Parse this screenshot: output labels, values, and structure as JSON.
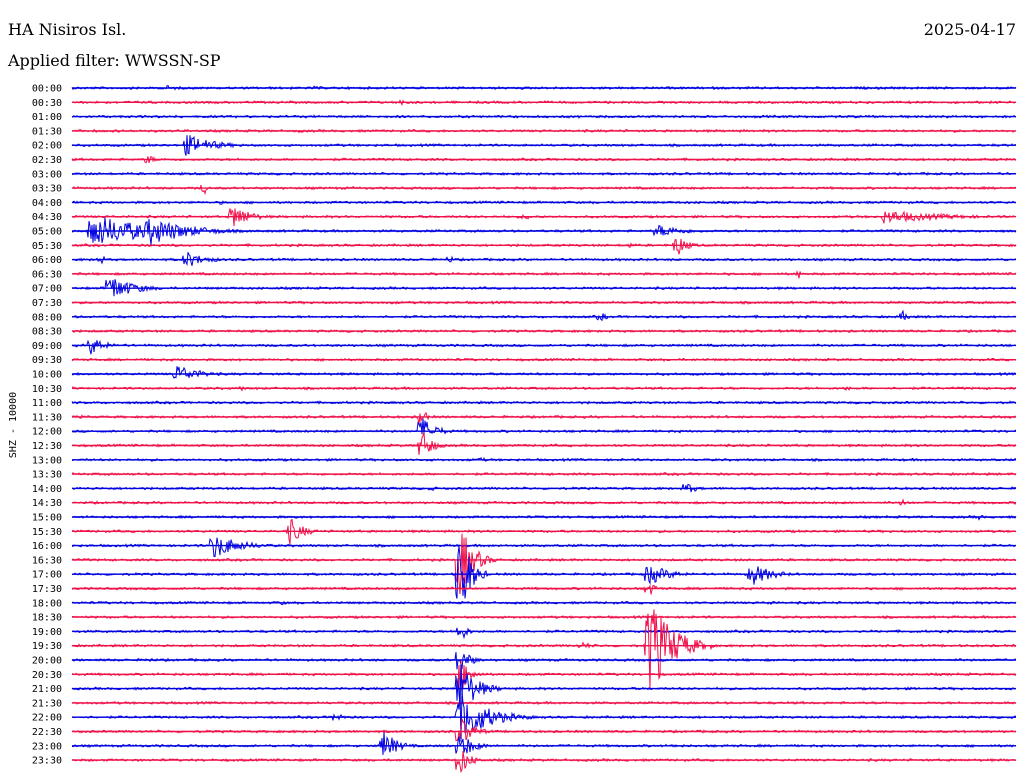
{
  "header": {
    "station": "HA Nisiros Isl.",
    "date": "2025-04-17",
    "filter": "Applied filter: WWSSN-SP"
  },
  "chart_data": {
    "type": "line",
    "title": "HA Nisiros Isl.",
    "ylabel": "SHZ - 10000",
    "colors": [
      "#0000e0",
      "#f0104a"
    ],
    "rows": [
      "00:00",
      "00:30",
      "01:00",
      "01:30",
      "02:00",
      "02:30",
      "03:00",
      "03:30",
      "04:00",
      "04:30",
      "05:00",
      "05:30",
      "06:00",
      "06:30",
      "07:00",
      "07:30",
      "08:00",
      "08:30",
      "09:00",
      "09:30",
      "10:00",
      "10:30",
      "11:00",
      "11:30",
      "12:00",
      "12:30",
      "13:00",
      "13:30",
      "14:00",
      "14:30",
      "15:00",
      "15:30",
      "16:00",
      "16:30",
      "17:00",
      "17:30",
      "18:00",
      "18:30",
      "19:00",
      "19:30",
      "20:00",
      "20:30",
      "21:00",
      "21:30",
      "22:00",
      "22:30",
      "23:00",
      "23:30"
    ],
    "events": [
      {
        "row": 0,
        "x": 0.1,
        "amp": 3,
        "dur": 0.05
      },
      {
        "row": 0,
        "x": 0.26,
        "amp": 3,
        "dur": 0.01
      },
      {
        "row": 1,
        "x": 0.35,
        "amp": 4,
        "dur": 0.02
      },
      {
        "row": 1,
        "x": 0.52,
        "amp": 2,
        "dur": 0.01
      },
      {
        "row": 3,
        "x": 0.05,
        "amp": 2,
        "dur": 0.01
      },
      {
        "row": 3,
        "x": 0.24,
        "amp": 2,
        "dur": 0.02
      },
      {
        "row": 4,
        "x": 0.12,
        "amp": 12,
        "dur": 0.08
      },
      {
        "row": 4,
        "x": 0.28,
        "amp": 2,
        "dur": 0.02
      },
      {
        "row": 4,
        "x": 0.99,
        "amp": 2,
        "dur": 0.01
      },
      {
        "row": 5,
        "x": 0.08,
        "amp": 6,
        "dur": 0.02
      },
      {
        "row": 7,
        "x": 0.14,
        "amp": 7,
        "dur": 0.01
      },
      {
        "row": 8,
        "x": 0.16,
        "amp": 3,
        "dur": 0.01
      },
      {
        "row": 9,
        "x": 0.17,
        "amp": 14,
        "dur": 0.05
      },
      {
        "row": 9,
        "x": 0.48,
        "amp": 3,
        "dur": 0.03
      },
      {
        "row": 9,
        "x": 0.86,
        "amp": 7,
        "dur": 0.18
      },
      {
        "row": 10,
        "x": 0.02,
        "amp": 18,
        "dur": 0.17
      },
      {
        "row": 10,
        "x": 0.08,
        "amp": 16,
        "dur": 0.12
      },
      {
        "row": 10,
        "x": 0.62,
        "amp": 7,
        "dur": 0.08
      },
      {
        "row": 11,
        "x": 0.59,
        "amp": 3,
        "dur": 0.03
      },
      {
        "row": 11,
        "x": 0.64,
        "amp": 13,
        "dur": 0.03
      },
      {
        "row": 12,
        "x": 0.03,
        "amp": 5,
        "dur": 0.02
      },
      {
        "row": 12,
        "x": 0.12,
        "amp": 9,
        "dur": 0.06
      },
      {
        "row": 12,
        "x": 0.4,
        "amp": 4,
        "dur": 0.02
      },
      {
        "row": 12,
        "x": 0.76,
        "amp": 2,
        "dur": 0.01
      },
      {
        "row": 13,
        "x": 0.77,
        "amp": 5,
        "dur": 0.01
      },
      {
        "row": 14,
        "x": 0.04,
        "amp": 14,
        "dur": 0.07
      },
      {
        "row": 15,
        "x": 0.34,
        "amp": 2,
        "dur": 0.03
      },
      {
        "row": 16,
        "x": 0.56,
        "amp": 5,
        "dur": 0.02
      },
      {
        "row": 16,
        "x": 0.88,
        "amp": 6,
        "dur": 0.02
      },
      {
        "row": 18,
        "x": 0.02,
        "amp": 10,
        "dur": 0.04
      },
      {
        "row": 18,
        "x": 0.85,
        "amp": 2,
        "dur": 0.01
      },
      {
        "row": 20,
        "x": 0.11,
        "amp": 10,
        "dur": 0.07
      },
      {
        "row": 21,
        "x": 0.18,
        "amp": 3,
        "dur": 0.01
      },
      {
        "row": 21,
        "x": 0.82,
        "amp": 3,
        "dur": 0.02
      },
      {
        "row": 23,
        "x": 0.01,
        "amp": 2,
        "dur": 0.01
      },
      {
        "row": 23,
        "x": 0.37,
        "amp": 18,
        "dur": 0.01
      },
      {
        "row": 24,
        "x": 0.37,
        "amp": 16,
        "dur": 0.04
      },
      {
        "row": 25,
        "x": 0.37,
        "amp": 18,
        "dur": 0.03
      },
      {
        "row": 26,
        "x": 0.43,
        "amp": 3,
        "dur": 0.03
      },
      {
        "row": 28,
        "x": 0.38,
        "amp": 3,
        "dur": 0.02
      },
      {
        "row": 28,
        "x": 0.65,
        "amp": 7,
        "dur": 0.03
      },
      {
        "row": 29,
        "x": 0.88,
        "amp": 4,
        "dur": 0.02
      },
      {
        "row": 30,
        "x": 0.96,
        "amp": 3,
        "dur": 0.02
      },
      {
        "row": 31,
        "x": 0.23,
        "amp": 15,
        "dur": 0.04
      },
      {
        "row": 32,
        "x": 0.15,
        "amp": 13,
        "dur": 0.08
      },
      {
        "row": 33,
        "x": 0.41,
        "amp": 40,
        "dur": 0.04
      },
      {
        "row": 34,
        "x": 0.41,
        "amp": 55,
        "dur": 0.03
      },
      {
        "row": 34,
        "x": 0.61,
        "amp": 12,
        "dur": 0.06
      },
      {
        "row": 34,
        "x": 0.72,
        "amp": 12,
        "dur": 0.06
      },
      {
        "row": 35,
        "x": 0.61,
        "amp": 10,
        "dur": 0.02
      },
      {
        "row": 36,
        "x": 0.06,
        "amp": 2,
        "dur": 0.01
      },
      {
        "row": 36,
        "x": 0.22,
        "amp": 3,
        "dur": 0.02
      },
      {
        "row": 36,
        "x": 0.74,
        "amp": 3,
        "dur": 0.02
      },
      {
        "row": 38,
        "x": 0.41,
        "amp": 14,
        "dur": 0.02
      },
      {
        "row": 39,
        "x": 0.54,
        "amp": 4,
        "dur": 0.04
      },
      {
        "row": 39,
        "x": 0.61,
        "amp": 55,
        "dur": 0.07
      },
      {
        "row": 40,
        "x": 0.08,
        "amp": 3,
        "dur": 0.02
      },
      {
        "row": 40,
        "x": 0.41,
        "amp": 16,
        "dur": 0.03
      },
      {
        "row": 41,
        "x": 0.41,
        "amp": 22,
        "dur": 0.03
      },
      {
        "row": 42,
        "x": 0.41,
        "amp": 30,
        "dur": 0.05
      },
      {
        "row": 43,
        "x": 0.1,
        "amp": 2,
        "dur": 0.02
      },
      {
        "row": 43,
        "x": 0.25,
        "amp": 2,
        "dur": 0.01
      },
      {
        "row": 44,
        "x": 0.28,
        "amp": 6,
        "dur": 0.02
      },
      {
        "row": 44,
        "x": 0.41,
        "amp": 30,
        "dur": 0.08
      },
      {
        "row": 45,
        "x": 0.41,
        "amp": 18,
        "dur": 0.04
      },
      {
        "row": 46,
        "x": 0.33,
        "amp": 16,
        "dur": 0.04
      },
      {
        "row": 46,
        "x": 0.41,
        "amp": 16,
        "dur": 0.04
      },
      {
        "row": 46,
        "x": 0.64,
        "amp": 3,
        "dur": 0.01
      },
      {
        "row": 47,
        "x": 0.41,
        "amp": 18,
        "dur": 0.03
      }
    ]
  }
}
